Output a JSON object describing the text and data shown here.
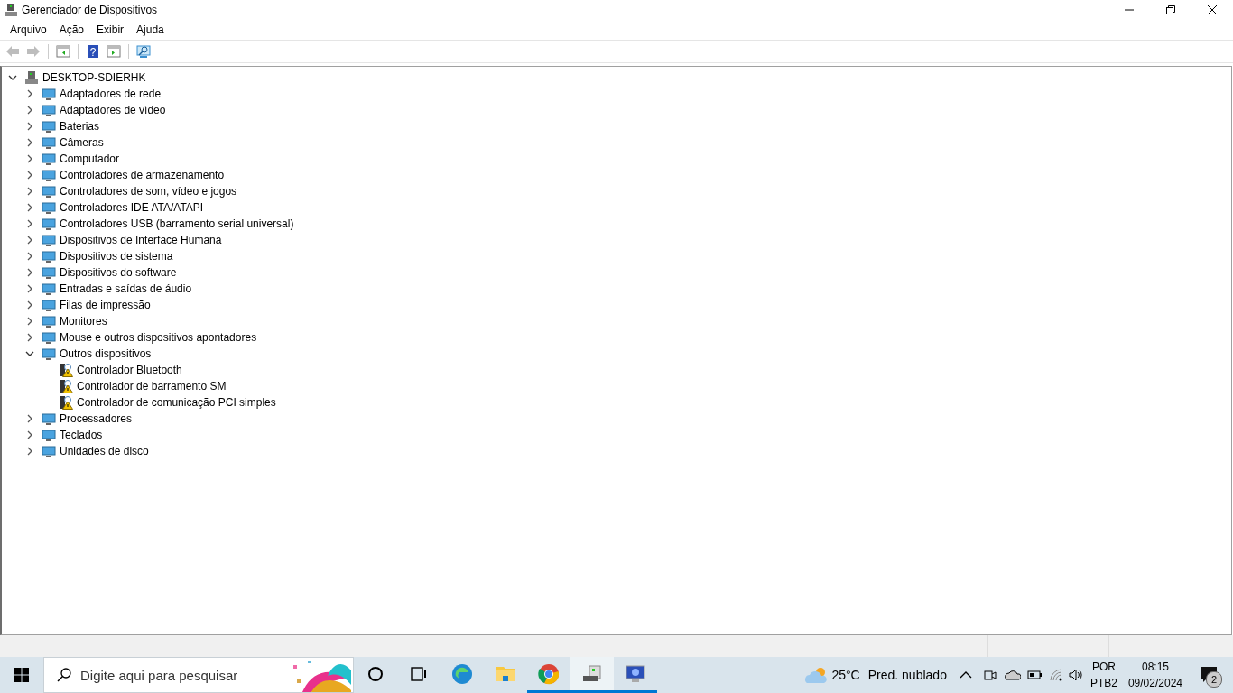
{
  "window": {
    "title": "Gerenciador de Dispositivos"
  },
  "menu": [
    "Arquivo",
    "Ação",
    "Exibir",
    "Ajuda"
  ],
  "toolbar": [
    {
      "kind": "back",
      "disabled": true
    },
    {
      "kind": "forward",
      "disabled": true
    },
    {
      "kind": "sep"
    },
    {
      "kind": "panel"
    },
    {
      "kind": "sep"
    },
    {
      "kind": "help",
      "glyph": "?"
    },
    {
      "kind": "panel2"
    },
    {
      "kind": "sep"
    },
    {
      "kind": "scan"
    }
  ],
  "tree": {
    "label": "DESKTOP-SDIERHK",
    "expanded": true,
    "children": [
      {
        "label": "Adaptadores de rede",
        "expanded": false
      },
      {
        "label": "Adaptadores de vídeo",
        "expanded": false
      },
      {
        "label": "Baterias",
        "expanded": false
      },
      {
        "label": "Câmeras",
        "expanded": false
      },
      {
        "label": "Computador",
        "expanded": false
      },
      {
        "label": "Controladores de armazenamento",
        "expanded": false
      },
      {
        "label": "Controladores de som, vídeo e jogos",
        "expanded": false
      },
      {
        "label": "Controladores IDE ATA/ATAPI",
        "expanded": false
      },
      {
        "label": "Controladores USB (barramento serial universal)",
        "expanded": false
      },
      {
        "label": "Dispositivos de Interface Humana",
        "expanded": false
      },
      {
        "label": "Dispositivos de sistema",
        "expanded": false
      },
      {
        "label": "Dispositivos do software",
        "expanded": false
      },
      {
        "label": "Entradas e saídas de áudio",
        "expanded": false
      },
      {
        "label": "Filas de impressão",
        "expanded": false
      },
      {
        "label": "Monitores",
        "expanded": false
      },
      {
        "label": "Mouse e outros dispositivos apontadores",
        "expanded": false
      },
      {
        "label": "Outros dispositivos",
        "expanded": true,
        "children": [
          {
            "label": "Controlador Bluetooth",
            "warning": true
          },
          {
            "label": "Controlador de barramento SM",
            "warning": true
          },
          {
            "label": "Controlador de comunicação PCI simples",
            "warning": true
          }
        ]
      },
      {
        "label": "Processadores",
        "expanded": false
      },
      {
        "label": "Teclados",
        "expanded": false
      },
      {
        "label": "Unidades de disco",
        "expanded": false
      }
    ]
  },
  "taskbar": {
    "search_placeholder": "Digite aqui para pesquisar",
    "apps": [
      {
        "kind": "browser",
        "running": false,
        "selected": false
      },
      {
        "kind": "folder",
        "running": false,
        "selected": false
      },
      {
        "kind": "wheel",
        "running": true,
        "selected": false
      },
      {
        "kind": "device",
        "running": true,
        "selected": true
      },
      {
        "kind": "monitor",
        "running": true,
        "selected": false
      }
    ],
    "weather": {
      "temp": "25°C",
      "text": "Pred. nublado"
    },
    "lang": "POR",
    "layout": "PTB2",
    "time": "08:15",
    "date": "09/02/2024",
    "notifications": "2"
  }
}
